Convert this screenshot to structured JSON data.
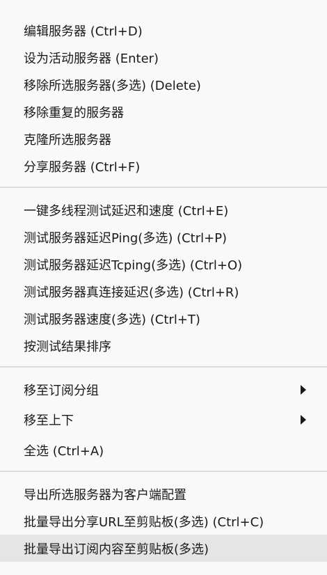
{
  "menu": {
    "groups": [
      {
        "items": [
          {
            "label": "编辑服务器 (Ctrl+D)"
          },
          {
            "label": "设为活动服务器 (Enter)"
          },
          {
            "label": "移除所选服务器(多选) (Delete)"
          },
          {
            "label": "移除重复的服务器"
          },
          {
            "label": "克隆所选服务器"
          },
          {
            "label": "分享服务器 (Ctrl+F)"
          }
        ]
      },
      {
        "items": [
          {
            "label": "一键多线程测试延迟和速度 (Ctrl+E)"
          },
          {
            "label": "测试服务器延迟Ping(多选) (Ctrl+P)"
          },
          {
            "label": "测试服务器延迟Tcping(多选) (Ctrl+O)"
          },
          {
            "label": "测试服务器真连接延迟(多选) (Ctrl+R)"
          },
          {
            "label": "测试服务器速度(多选) (Ctrl+T)"
          },
          {
            "label": "按测试结果排序"
          }
        ]
      },
      {
        "items": [
          {
            "label": "移至订阅分组",
            "submenu_icon": "chevron-right-icon"
          },
          {
            "label": "移至上下",
            "submenu_icon": "chevron-right-icon"
          },
          {
            "label": "全选 (Ctrl+A)"
          }
        ]
      },
      {
        "items": [
          {
            "label": "导出所选服务器为客户端配置"
          },
          {
            "label": "批量导出分享URL至剪贴板(多选) (Ctrl+C)"
          },
          {
            "label": "批量导出订阅内容至剪贴板(多选)",
            "highlighted": true
          }
        ]
      }
    ]
  },
  "colors": {
    "background": "#f9f9f9",
    "text": "#1a1a1a",
    "separator": "#dcdcdc",
    "highlight": "#e5e5e5"
  }
}
